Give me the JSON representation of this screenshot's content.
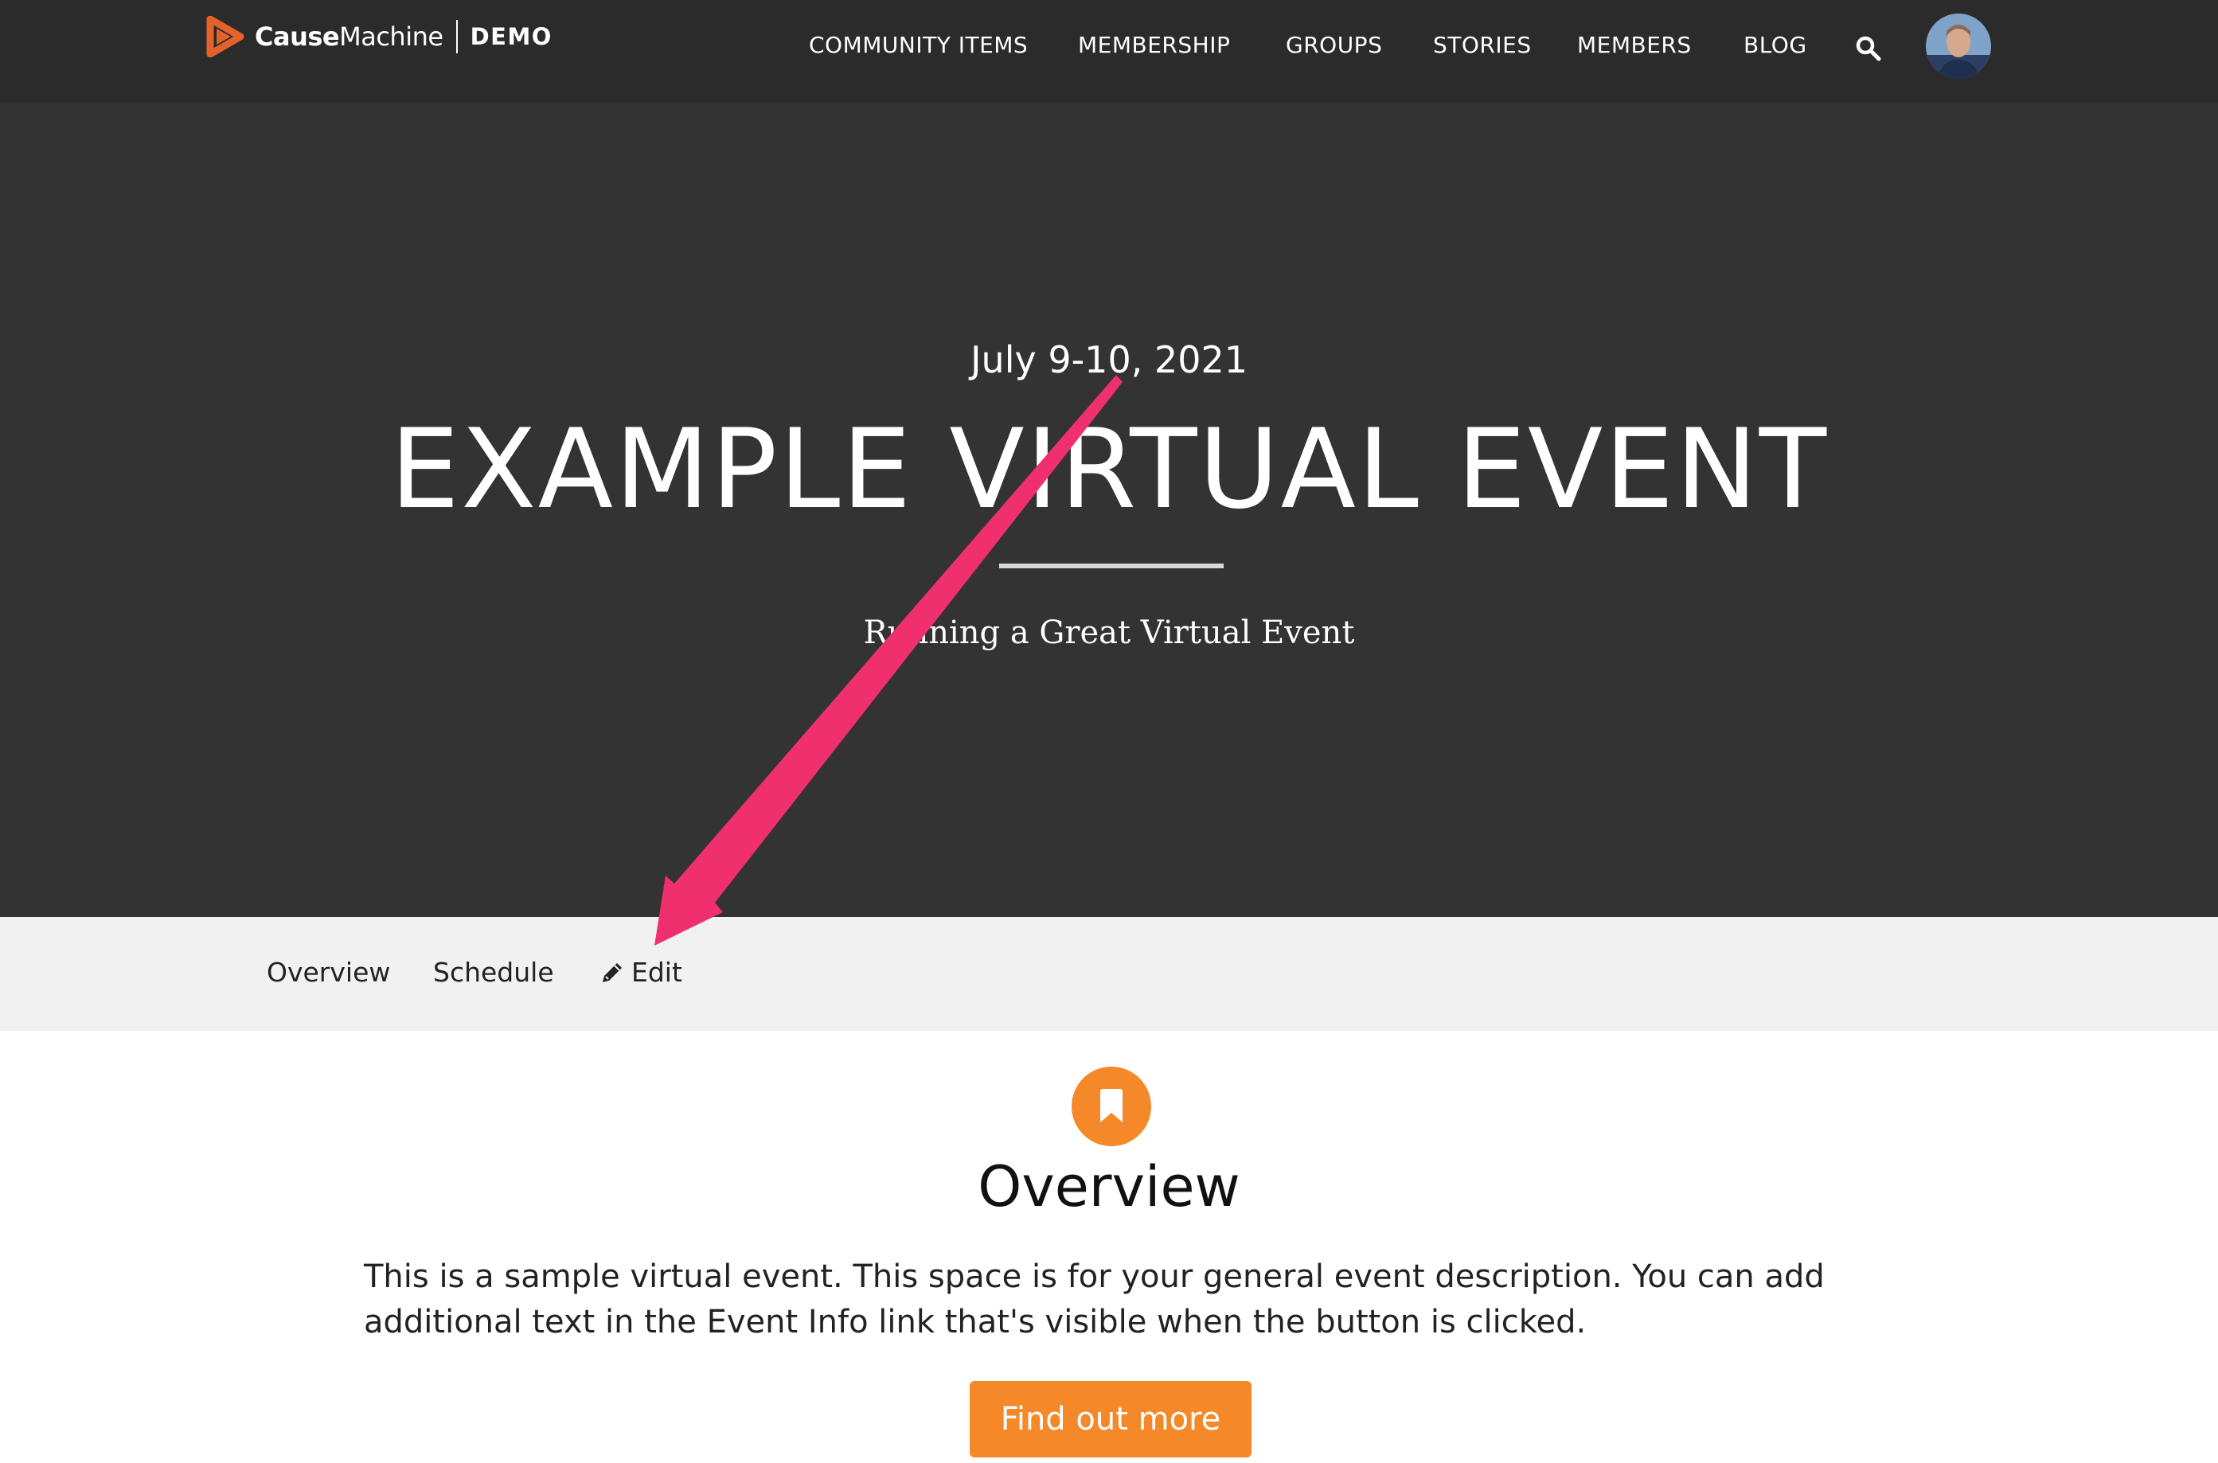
{
  "header": {
    "logo": {
      "brand_bold": "Cause",
      "brand_light": "Machine",
      "tag": "DEMO"
    },
    "nav": [
      {
        "label": "COMMUNITY ITEMS"
      },
      {
        "label": "MEMBERSHIP"
      },
      {
        "label": "GROUPS"
      },
      {
        "label": "STORIES"
      },
      {
        "label": "MEMBERS"
      },
      {
        "label": "BLOG"
      }
    ],
    "search_icon": "search-icon",
    "avatar_icon": "user-avatar"
  },
  "hero": {
    "date": "July 9-10, 2021",
    "title": "EXAMPLE VIRTUAL EVENT",
    "subtitle": "Running a Great Virtual Event"
  },
  "tabs": [
    {
      "label": "Overview"
    },
    {
      "label": "Schedule"
    },
    {
      "label": "Edit",
      "icon": "pencil-icon"
    }
  ],
  "overview": {
    "icon": "bookmark-icon",
    "heading": "Overview",
    "body": "This is a sample virtual event.  This space is for your general event description.  You can add additional text in the Event Info link that's visible when the button is clicked.",
    "button_label": "Find out more"
  },
  "colors": {
    "topbar": "#2b2b2b",
    "hero": "#333333",
    "tabbar": "#f1f1f1",
    "accent": "#f5892a",
    "logo": "#e2622a",
    "annotation_arrow": "#f0306e"
  }
}
